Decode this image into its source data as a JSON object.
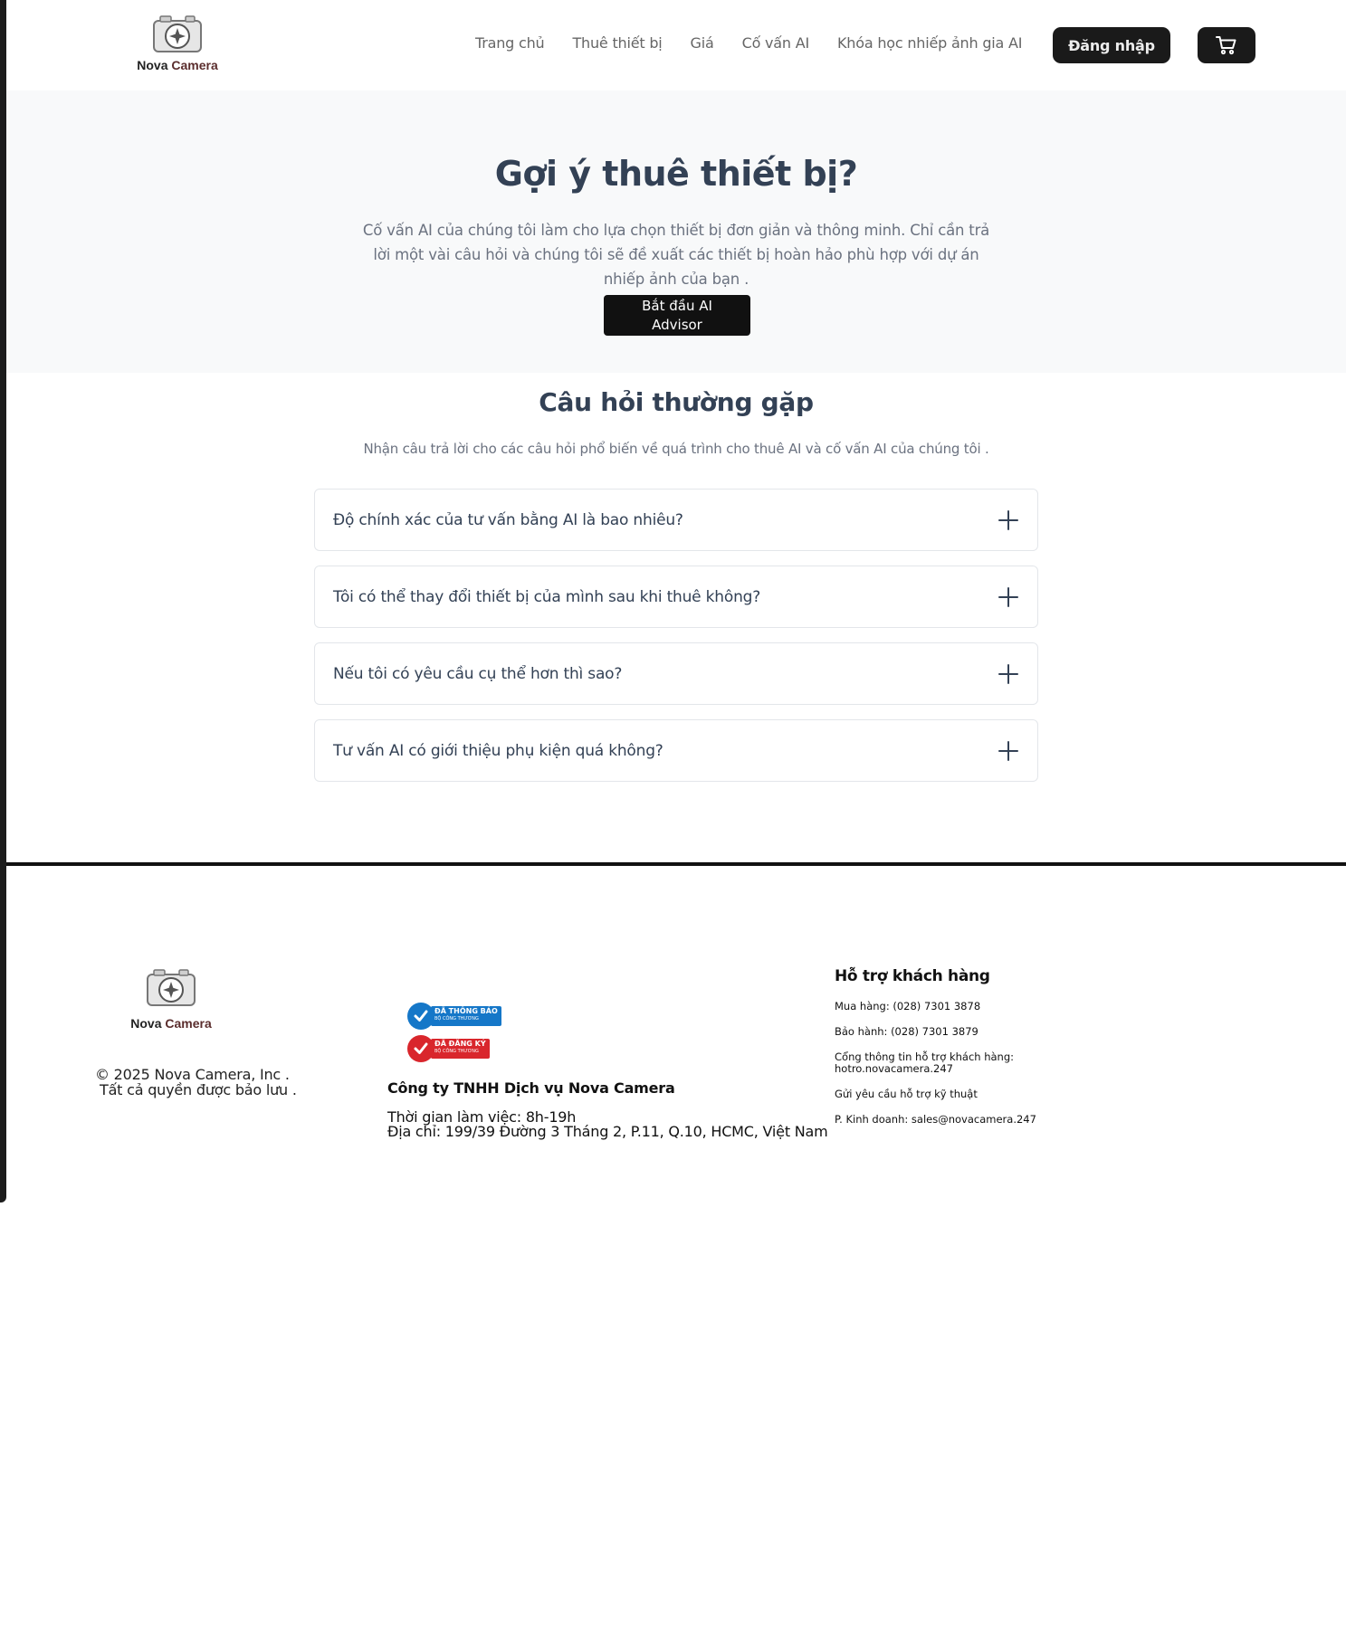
{
  "brand": {
    "name_part1": "Nova",
    "name_part2": "Camera"
  },
  "nav": {
    "items": [
      {
        "label": "Trang chủ"
      },
      {
        "label": "Thuê thiết bị"
      },
      {
        "label": "Giá"
      },
      {
        "label": "Cố vấn AI"
      },
      {
        "label": "Khóa học nhiếp ảnh gia AI"
      }
    ],
    "login_label": "Đăng nhập",
    "cart_icon": "cart-icon"
  },
  "hero": {
    "title": "Gợi ý thuê thiết bị?",
    "description": "Cố vấn AI của chúng tôi làm cho lựa chọn thiết bị đơn giản và thông minh. Chỉ cần trả lời một vài câu hỏi và chúng tôi sẽ đề xuất các thiết bị hoàn hảo phù hợp với dự án nhiếp ảnh của bạn .",
    "cta_label": "Bắt đầu AI Advisor"
  },
  "faq": {
    "title": "Câu hỏi thường gặp",
    "subtitle": "Nhận câu trả lời cho các câu hỏi phổ biến về quá trình cho thuê AI và cố vấn AI của chúng tôi .",
    "items": [
      {
        "question": "Độ chính xác của tư vấn bằng AI là bao nhiêu?"
      },
      {
        "question": "Tôi có thể thay đổi thiết bị của mình sau khi thuê không?"
      },
      {
        "question": "Nếu tôi có yêu cầu cụ thể hơn thì sao?"
      },
      {
        "question": "Tư vấn AI có giới thiệu phụ kiện quá không?"
      }
    ]
  },
  "footer": {
    "copyright_line1": "© 2025 Nova Camera, Inc .",
    "copyright_line2": "Tất cả quyền được bảo lưu .",
    "badges": {
      "notified_title": "ĐÃ THÔNG BÁO",
      "notified_sub": "BỘ CÔNG THƯƠNG",
      "registered_title": "ĐÃ ĐĂNG KÝ",
      "registered_sub": "BỘ CÔNG THƯƠNG"
    },
    "company_name": "Công ty TNHH Dịch vụ Nova Camera",
    "working_hours": "Thời gian làm việc: 8h-19h",
    "address": "Địa chỉ: 199/39 Đường 3 Tháng 2, P.11, Q.10, HCMC, Việt Nam",
    "support": {
      "title": "Hỗ trợ khách hàng",
      "purchase": "Mua hàng: (028) 7301 3878",
      "warranty": "Bảo hành: (028) 7301 3879",
      "portal": "Cổng thông tin hỗ trợ khách hàng: hotro.novacamera.247",
      "tech_request": "Gửi yêu cầu hỗ trợ kỹ thuật",
      "sales": "P. Kinh doanh: sales@novacamera.247"
    }
  },
  "colors": {
    "dark_button": "#1a1a1a",
    "hero_bg": "#f8f9fa",
    "heading": "#334155",
    "muted_text": "#6b7280",
    "badge_blue": "#1577c8",
    "badge_red": "#d9262c"
  }
}
